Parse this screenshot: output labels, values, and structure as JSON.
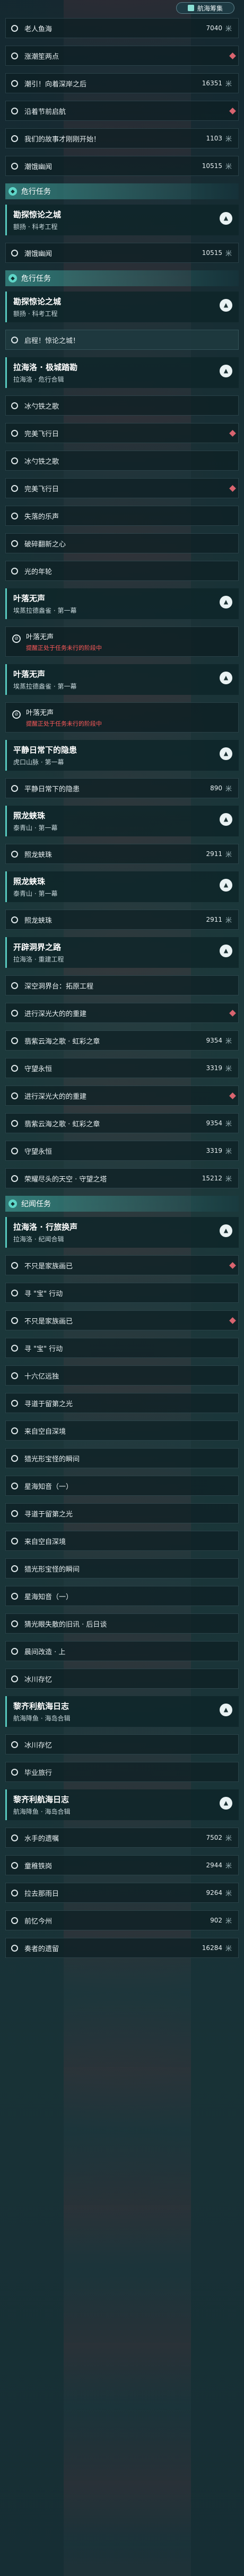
{
  "nav_badge": "航海筹集",
  "top_rows": [
    {
      "label": "老人鱼海",
      "count": "7040",
      "unit": "米",
      "diamond": false
    },
    {
      "label": "涨潮笙两点",
      "count": "",
      "unit": "",
      "diamond": true
    },
    {
      "label": "潮引！向着深岸之后",
      "count": "16351",
      "unit": "米",
      "diamond": false
    },
    {
      "label": "沿着节前启航",
      "count": "",
      "unit": "",
      "diamond": true
    },
    {
      "label": "我们的故事才刚刚开始！",
      "count": "1103",
      "unit": "米",
      "diamond": false
    },
    {
      "label": "潮饿幽闻",
      "count": "10515",
      "unit": "米",
      "diamond": false
    }
  ],
  "section_side": {
    "label": "危行任务",
    "icon": "B"
  },
  "tasks_side_header": {
    "title": "勘探惊论之城",
    "sub": "额扬 · 科考工程"
  },
  "side_row": {
    "label": "潮饿幽闻",
    "count": "10515",
    "unit": "米"
  },
  "section_side2": {
    "label": "危行任务"
  },
  "group_a": {
    "title": "勘探惊论之城",
    "sub": "额扬 · 科考工程"
  },
  "row_a1": {
    "label": "启程！惊论之城！"
  },
  "group_b": {
    "title": "拉海洛 · 极城踏勘",
    "sub": "拉海洛 · 危行合辑"
  },
  "rows_b": [
    {
      "label": "冰勺铁之歌",
      "diamond": false
    },
    {
      "label": "完美飞行日",
      "diamond": true
    },
    {
      "label": "冰勺铁之歌",
      "diamond": false
    },
    {
      "label": "完美飞行日",
      "diamond": true
    },
    {
      "label": "失落的乐声",
      "diamond": false
    },
    {
      "label": "破碎翻新之心",
      "diamond": false
    },
    {
      "label": "光的年轮",
      "diamond": false
    }
  ],
  "group_c": {
    "title": "叶落无声",
    "sub": "埃蒸拉德盎雀 · 第一幕"
  },
  "note_c": {
    "text": "叶落无声",
    "warn": "提醒正处于任务未行的阶段中"
  },
  "group_c2": {
    "title": "叶落无声",
    "sub": "埃蒸拉德盎雀 · 第一幕"
  },
  "note_c2": {
    "text": "叶落无声",
    "warn": "提醒正处于任务未行的阶段中"
  },
  "group_d": {
    "title": "平静日常下的隐患",
    "sub": "虎口山脉 · 第一幕"
  },
  "row_d": {
    "label": "平静日常下的隐患",
    "count": "890",
    "unit": "米"
  },
  "group_e": {
    "title": "照龙蛱珠",
    "sub": "泰青山 · 第一幕"
  },
  "row_e": {
    "label": "照龙蛱珠",
    "count": "2911",
    "unit": "米"
  },
  "group_e2": {
    "title": "照龙蛱珠",
    "sub": "泰青山 · 第一幕"
  },
  "row_e2": {
    "label": "照龙蛱珠",
    "count": "2911",
    "unit": "米"
  },
  "group_f": {
    "title": "开辟洞界之路",
    "sub": "拉海洛 · 重建工程"
  },
  "rows_f": [
    {
      "label": "深空洞界台：拓原工程",
      "count": "",
      "unit": "",
      "diamond": false
    },
    {
      "label": "进行深光大的的重建",
      "count": "",
      "unit": "",
      "diamond": true
    },
    {
      "label": "翡紫云海之歌 · 虹彩之章",
      "count": "9354",
      "unit": "米",
      "diamond": false
    },
    {
      "label": "守望永恒",
      "count": "3319",
      "unit": "米",
      "diamond": false
    },
    {
      "label": "进行深光大的的重建",
      "count": "",
      "unit": "",
      "diamond": true
    },
    {
      "label": "翡紫云海之歌 · 虹彩之章",
      "count": "9354",
      "unit": "米",
      "diamond": false
    },
    {
      "label": "守望永恒",
      "count": "3319",
      "unit": "米",
      "diamond": false
    },
    {
      "label": "荣耀尽头的天空 · 守望之塔",
      "count": "15212",
      "unit": "米",
      "diamond": false
    }
  ],
  "section_rec": {
    "label": "纪闻任务"
  },
  "group_g": {
    "title": "拉海洛 · 行旅换声",
    "sub": "拉海洛 · 纪闻合辑"
  },
  "rows_g": [
    {
      "label": "不只是家族画已",
      "diamond": true
    },
    {
      "label": "寻 \"宝\" 行动",
      "diamond": false
    },
    {
      "label": "不只是家族画已",
      "diamond": true
    },
    {
      "label": "寻 \"宝\" 行动",
      "diamond": false
    },
    {
      "label": "十六亿远独",
      "diamond": false
    },
    {
      "label": "寻道于留第之光",
      "diamond": false
    },
    {
      "label": "来自空自深境",
      "diamond": false
    },
    {
      "label": "猎光形宝怪的瞬间",
      "diamond": false
    },
    {
      "label": "星海知音（一）",
      "diamond": false
    },
    {
      "label": "寻道于留第之光",
      "diamond": false
    },
    {
      "label": "来自空自深境",
      "diamond": false
    },
    {
      "label": "猎光形宝怪的瞬间",
      "diamond": false
    },
    {
      "label": "星海知音（一）",
      "diamond": false
    },
    {
      "label": "猜光眼失散的旧讯 · 后日谈",
      "diamond": false
    },
    {
      "label": "晨间改造 · 上",
      "diamond": false
    },
    {
      "label": "冰川存忆",
      "diamond": false
    }
  ],
  "group_h": {
    "title": "黎齐利航海日志",
    "sub": "航海降鱼 · 海岛合辑"
  },
  "rows_h": [
    {
      "label": "冰川存忆",
      "count": "",
      "unit": ""
    },
    {
      "label": "毕业旅行",
      "count": "",
      "unit": ""
    }
  ],
  "group_h2": {
    "title": "黎齐利航海日志",
    "sub": "航海降鱼 · 海岛合辑"
  },
  "rows_h2": [
    {
      "label": "水手的遗嘱",
      "count": "7502",
      "unit": "米"
    },
    {
      "label": "童稚铁岗",
      "count": "2944",
      "unit": "米"
    },
    {
      "label": "拉去那雨日",
      "count": "9264",
      "unit": "米"
    },
    {
      "label": "前忆今州",
      "count": "902",
      "unit": "米"
    },
    {
      "label": "奏者的遗留",
      "count": "16284",
      "unit": "米"
    }
  ]
}
